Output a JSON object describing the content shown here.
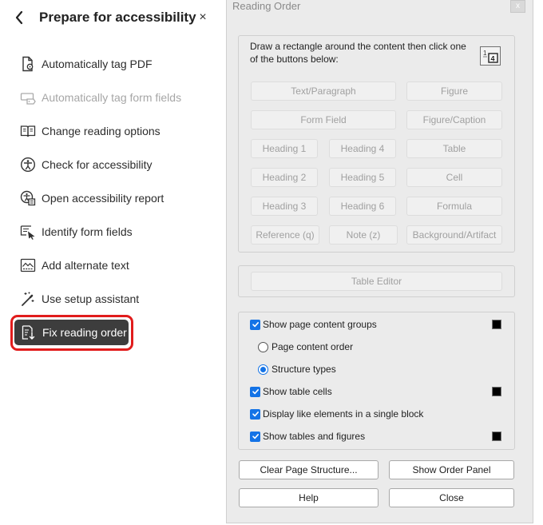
{
  "left_panel": {
    "title": "Prepare for accessibility",
    "close_glyph": "×",
    "tools": [
      {
        "label": "Automatically tag PDF",
        "icon": "tag-pdf-icon",
        "enabled": true
      },
      {
        "label": "Automatically tag form fields",
        "icon": "tag-form-fields-icon",
        "enabled": false
      },
      {
        "label": "Change reading options",
        "icon": "reading-options-icon",
        "enabled": true
      },
      {
        "label": "Check for accessibility",
        "icon": "accessibility-check-icon",
        "enabled": true
      },
      {
        "label": "Open accessibility report",
        "icon": "accessibility-report-icon",
        "enabled": true
      },
      {
        "label": "Identify form fields",
        "icon": "identify-form-fields-icon",
        "enabled": true
      },
      {
        "label": "Add alternate text",
        "icon": "alternate-text-icon",
        "enabled": true
      },
      {
        "label": "Use setup assistant",
        "icon": "setup-assistant-icon",
        "enabled": true
      },
      {
        "label": "Fix reading order",
        "icon": "fix-reading-order-icon",
        "enabled": true,
        "selected": true
      }
    ],
    "highlight_color": "#e11c1c"
  },
  "dialog": {
    "title": "Reading Order",
    "close_glyph": "x",
    "instructions": "Draw a rectangle around the content then click one of the buttons below:",
    "tag_buttons": {
      "text_paragraph": "Text/Paragraph",
      "figure": "Figure",
      "form_field": "Form Field",
      "figure_caption": "Figure/Caption",
      "heading1": "Heading 1",
      "heading4": "Heading 4",
      "table": "Table",
      "heading2": "Heading 2",
      "heading5": "Heading 5",
      "cell": "Cell",
      "heading3": "Heading 3",
      "heading6": "Heading 6",
      "formula": "Formula",
      "reference": "Reference (q)",
      "note": "Note (z)",
      "background": "Background/Artifact"
    },
    "table_editor": "Table Editor",
    "options": {
      "show_page_content_groups": {
        "label": "Show page content groups",
        "checked": true
      },
      "page_content_order": {
        "label": "Page content order",
        "selected": false
      },
      "structure_types": {
        "label": "Structure types",
        "selected": true
      },
      "show_table_cells": {
        "label": "Show table cells",
        "checked": true
      },
      "display_like_elements": {
        "label": "Display like elements in a single block",
        "checked": true
      },
      "show_tables_and_figures": {
        "label": "Show tables and figures",
        "checked": true
      }
    },
    "buttons": {
      "clear_structure": "Clear Page Structure...",
      "show_order_panel": "Show Order Panel",
      "help": "Help",
      "close": "Close"
    },
    "checkbox_color": "#1473e6",
    "swatch_color": "#000000"
  }
}
